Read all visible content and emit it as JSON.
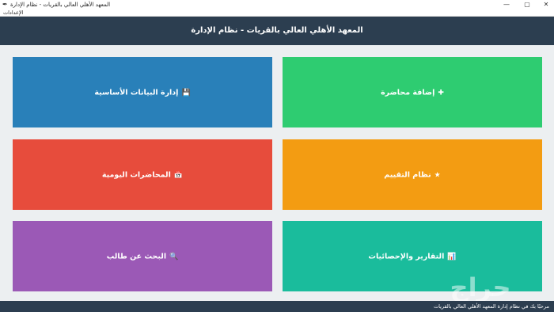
{
  "window": {
    "title": "المعهد الأهلي العالي بالقريات - نظام الإدارة",
    "icon": "feather-icon",
    "controls": {
      "minimize": "—",
      "maximize": "▢",
      "close": "✕"
    }
  },
  "menubar": {
    "settings_label": "الإعدادات"
  },
  "header": {
    "title": "المعهد الأهلي العالي بالقريات - نظام الإدارة"
  },
  "colors": {
    "header": "#2c3e50",
    "add_lecture": "#2ecc71",
    "basic_data": "#2980b9",
    "evaluation": "#f39c12",
    "daily_lectures": "#e74c3c",
    "reports": "#1abc9c",
    "student_search": "#9b59b6",
    "background": "#eceff1"
  },
  "tiles": {
    "add_lecture": {
      "label": "إضافة محاضرة",
      "icon": "plus-icon",
      "glyph": "✚"
    },
    "basic_data": {
      "label": "إدارة البيانات الأساسية",
      "icon": "floppy-disk-icon",
      "glyph": "💾"
    },
    "evaluation": {
      "label": "نظام التقييم",
      "icon": "star-icon",
      "glyph": "★"
    },
    "daily_lectures": {
      "label": "المحاضرات اليومية",
      "icon": "calendar-icon",
      "glyph": "📅"
    },
    "reports": {
      "label": "التقارير والإحصائيات",
      "icon": "chart-icon",
      "glyph": "📊"
    },
    "student_search": {
      "label": "البحث عن طالب",
      "icon": "magnifier-icon",
      "glyph": "🔍"
    }
  },
  "statusbar": {
    "text": "مرحبًا بك في نظام إدارة المعهد الأهلي العالي بالقريات"
  },
  "watermark": {
    "text": "حراج"
  }
}
